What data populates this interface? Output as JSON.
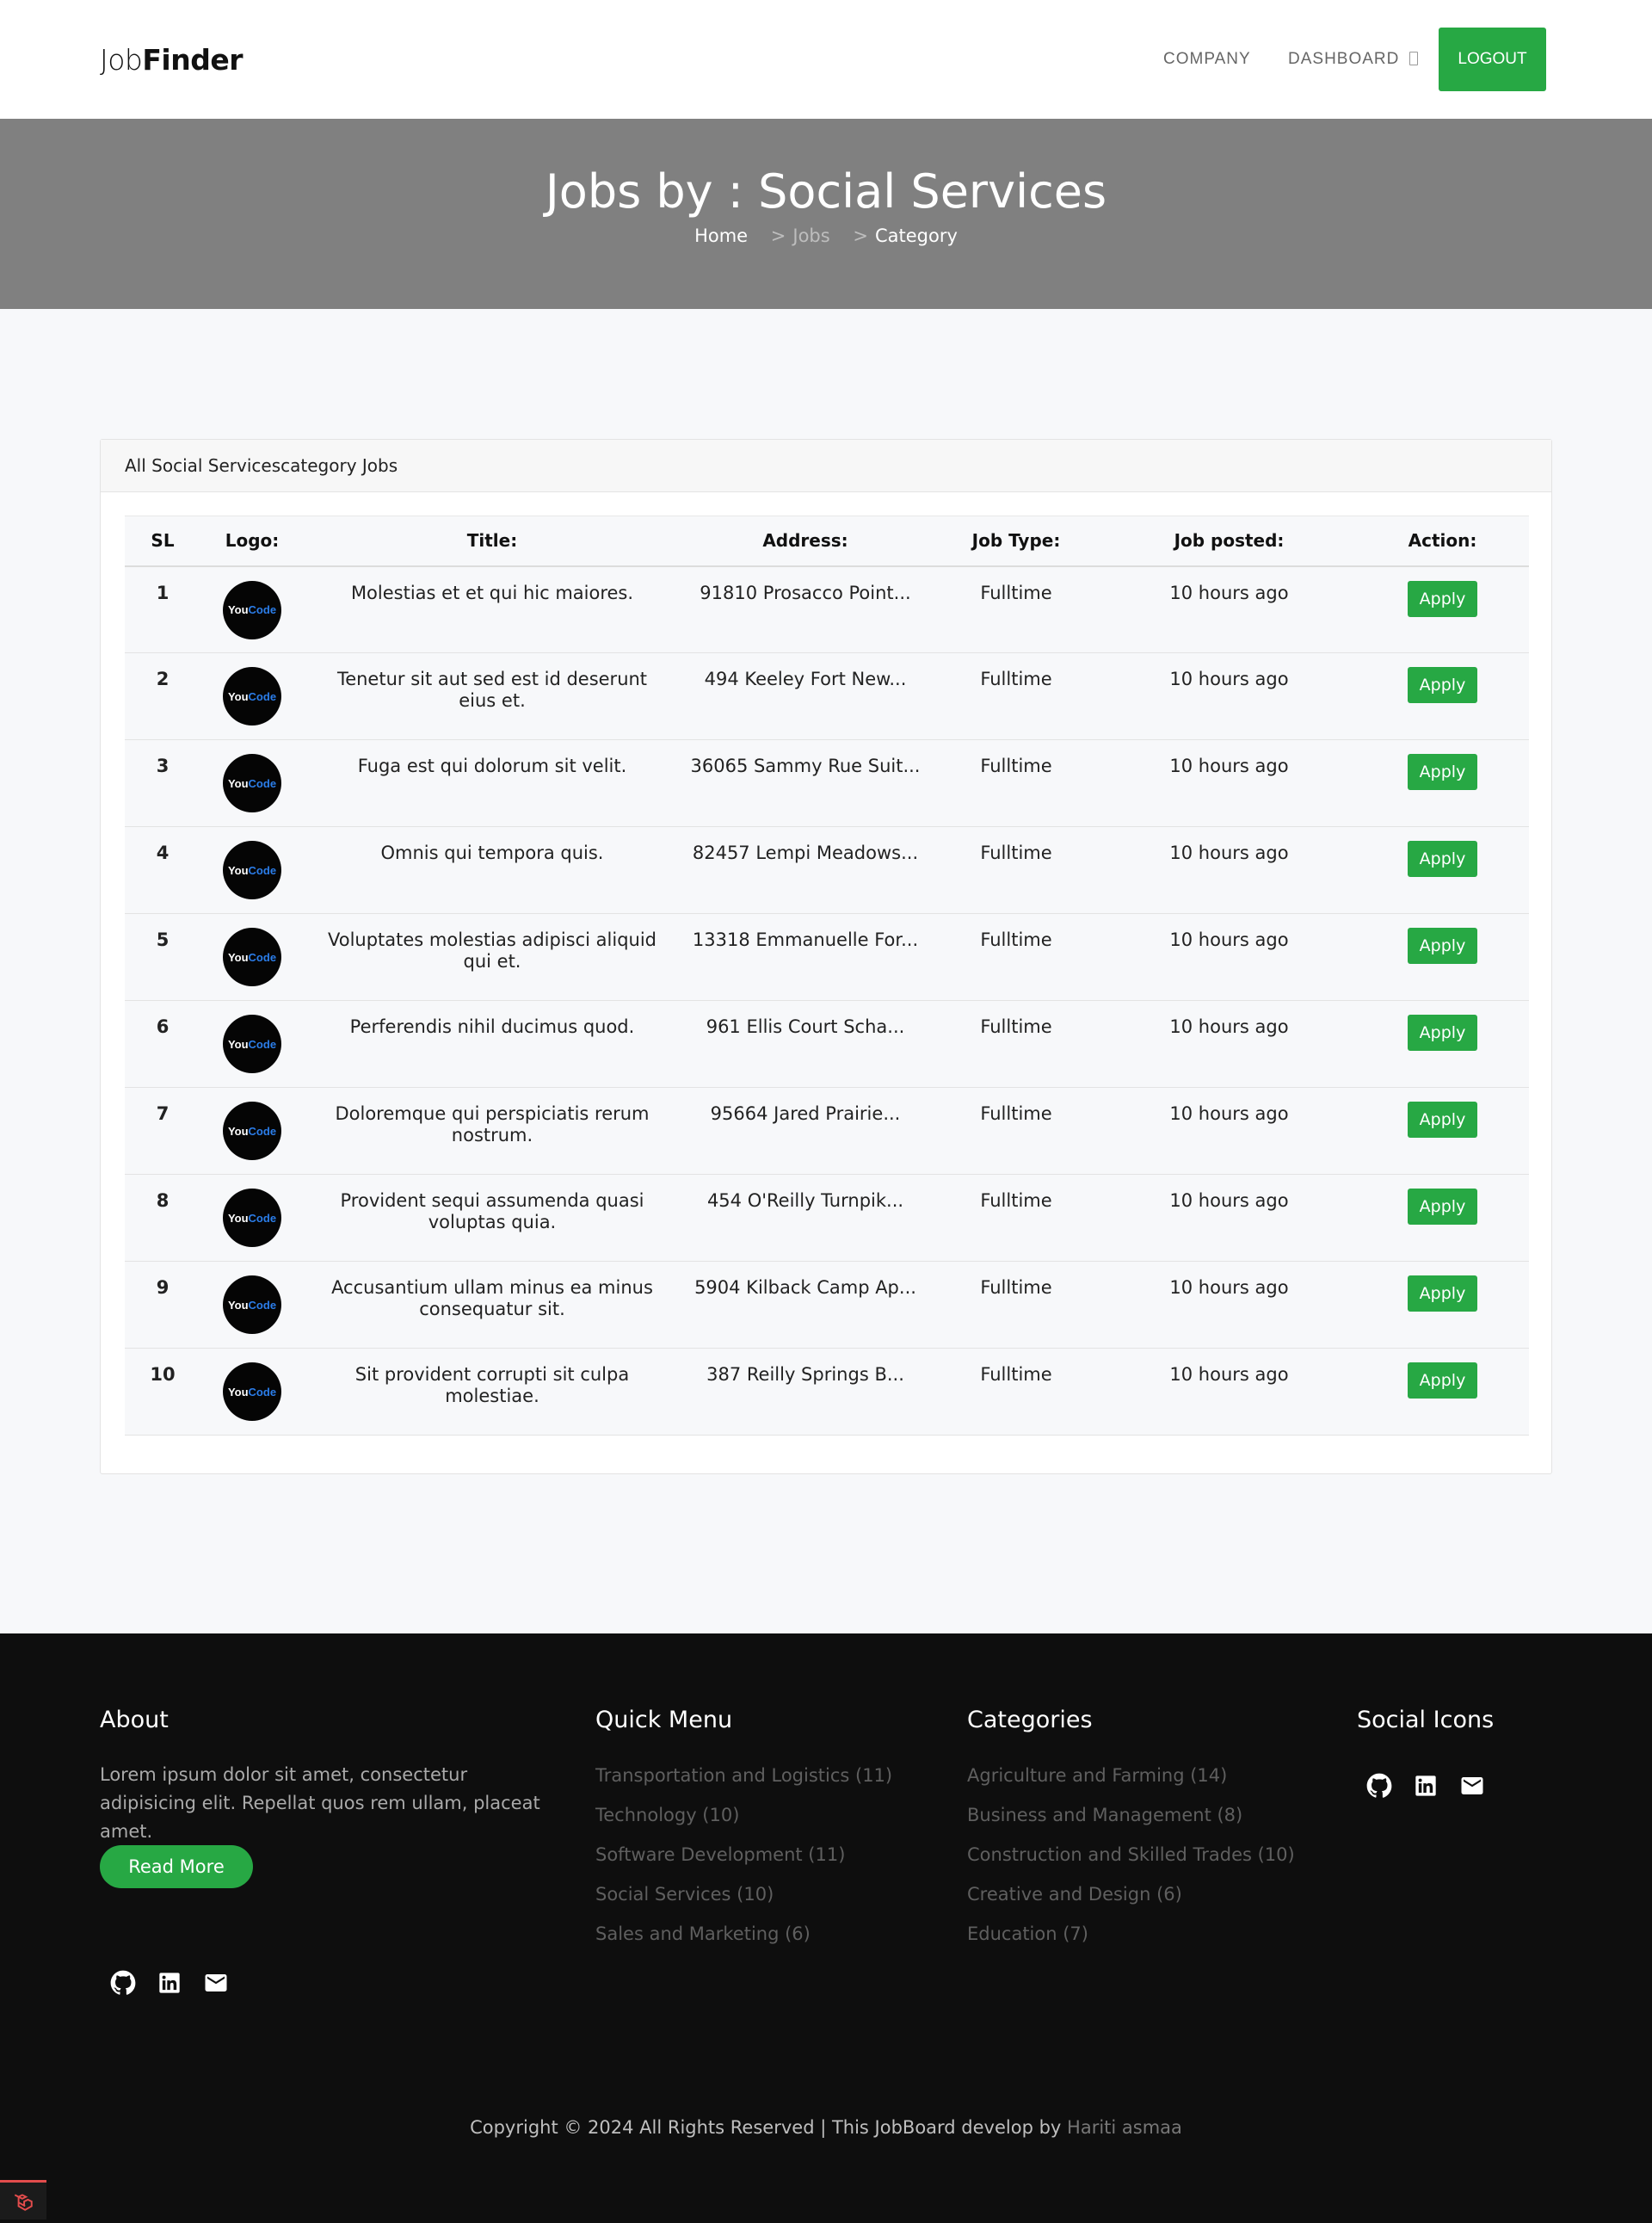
{
  "navbar": {
    "brand_light": "Job",
    "brand_bold": "Finder",
    "links": [
      "COMPANY",
      "DASHBOARD"
    ],
    "logout_label": "LOGOUT"
  },
  "hero": {
    "title": "Jobs by : Social Services",
    "breadcrumb": [
      "Home",
      "Jobs",
      "Category"
    ]
  },
  "card": {
    "header": "All Social Servicescategory Jobs",
    "columns": [
      "SL",
      "Logo:",
      "Title:",
      "Address:",
      "Job Type:",
      "Job posted:",
      "Action:"
    ],
    "logo_text_1": "You",
    "logo_text_2": "Code",
    "rows": [
      {
        "sl": "1",
        "title": "Molestias et et qui hic maiores.",
        "address": "91810 Prosacco Point...",
        "type": "Fulltime",
        "posted": "10 hours ago",
        "action": "Apply"
      },
      {
        "sl": "2",
        "title": "Tenetur sit aut sed est id deserunt eius et.",
        "address": "494 Keeley Fort New...",
        "type": "Fulltime",
        "posted": "10 hours ago",
        "action": "Apply"
      },
      {
        "sl": "3",
        "title": "Fuga est qui dolorum sit velit.",
        "address": "36065 Sammy Rue Suit...",
        "type": "Fulltime",
        "posted": "10 hours ago",
        "action": "Apply"
      },
      {
        "sl": "4",
        "title": "Omnis qui tempora quis.",
        "address": "82457 Lempi Meadows...",
        "type": "Fulltime",
        "posted": "10 hours ago",
        "action": "Apply"
      },
      {
        "sl": "5",
        "title": "Voluptates molestias adipisci aliquid qui et.",
        "address": "13318 Emmanuelle For...",
        "type": "Fulltime",
        "posted": "10 hours ago",
        "action": "Apply"
      },
      {
        "sl": "6",
        "title": "Perferendis nihil ducimus quod.",
        "address": "961 Ellis Court Scha...",
        "type": "Fulltime",
        "posted": "10 hours ago",
        "action": "Apply"
      },
      {
        "sl": "7",
        "title": "Doloremque qui perspiciatis rerum nostrum.",
        "address": "95664 Jared Prairie...",
        "type": "Fulltime",
        "posted": "10 hours ago",
        "action": "Apply"
      },
      {
        "sl": "8",
        "title": "Provident sequi assumenda quasi voluptas quia.",
        "address": "454 O'Reilly Turnpik...",
        "type": "Fulltime",
        "posted": "10 hours ago",
        "action": "Apply"
      },
      {
        "sl": "9",
        "title": "Accusantium ullam minus ea minus consequatur sit.",
        "address": "5904 Kilback Camp Ap...",
        "type": "Fulltime",
        "posted": "10 hours ago",
        "action": "Apply"
      },
      {
        "sl": "10",
        "title": "Sit provident corrupti sit culpa molestiae.",
        "address": "387 Reilly Springs B...",
        "type": "Fulltime",
        "posted": "10 hours ago",
        "action": "Apply"
      }
    ]
  },
  "footer": {
    "about_heading": "About",
    "about_text": "Lorem ipsum dolor sit amet, consectetur adipisicing elit. Repellat quos rem ullam, placeat amet.",
    "read_more": "Read More",
    "quick_heading": "Quick Menu",
    "quick_items": [
      "Transportation and Logistics (11)",
      "Technology (10)",
      "Software Development (11)",
      "Social Services (10)",
      "Sales and Marketing (6)"
    ],
    "categories_heading": "Categories",
    "category_items": [
      "Agriculture and Farming (14)",
      "Business and Management (8)",
      "Construction and Skilled Trades (10)",
      "Creative and Design (6)",
      "Education (7)"
    ],
    "social_heading": "Social Icons",
    "social_icons": [
      "github-icon",
      "linkedin-icon",
      "mail-icon"
    ],
    "copyright": "Copyright © 2024 All Rights Reserved | This JobBoard develop by ",
    "author": "Hariti asmaa"
  },
  "colors": {
    "accent": "#27a844",
    "hero_bg": "#808080",
    "footer_bg": "#0e0e0e"
  }
}
